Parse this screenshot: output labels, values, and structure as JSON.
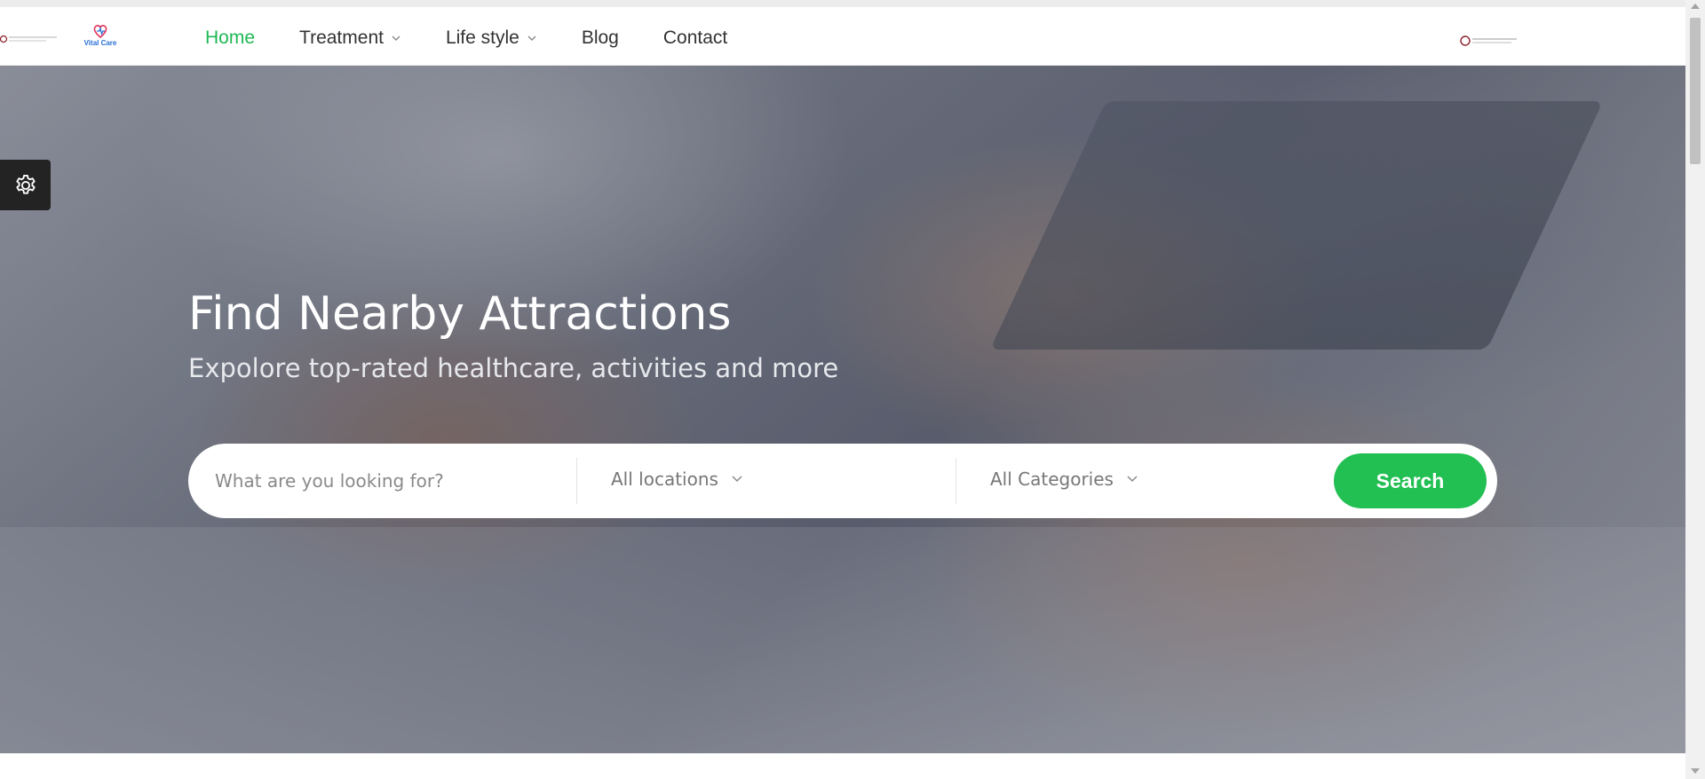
{
  "nav": {
    "items": [
      {
        "label": "Home",
        "active": true,
        "has_dropdown": false
      },
      {
        "label": "Treatment",
        "active": false,
        "has_dropdown": true
      },
      {
        "label": "Life style",
        "active": false,
        "has_dropdown": true
      },
      {
        "label": "Blog",
        "active": false,
        "has_dropdown": false
      },
      {
        "label": "Contact",
        "active": false,
        "has_dropdown": false
      }
    ]
  },
  "logo": {
    "text": "Vital Care"
  },
  "hero": {
    "title": "Find Nearby Attractions",
    "subtitle": "Expolore top-rated healthcare, activities and more"
  },
  "search": {
    "placeholder": "What are you looking for?",
    "location_value": "All locations",
    "category_value": "All Categories",
    "button_label": "Search"
  },
  "colors": {
    "accent": "#22bf52",
    "nav_active": "#1fb855",
    "settings_bg": "#232323"
  },
  "icons": {
    "settings": "gear-icon",
    "dropdown": "chevron-down-icon"
  }
}
